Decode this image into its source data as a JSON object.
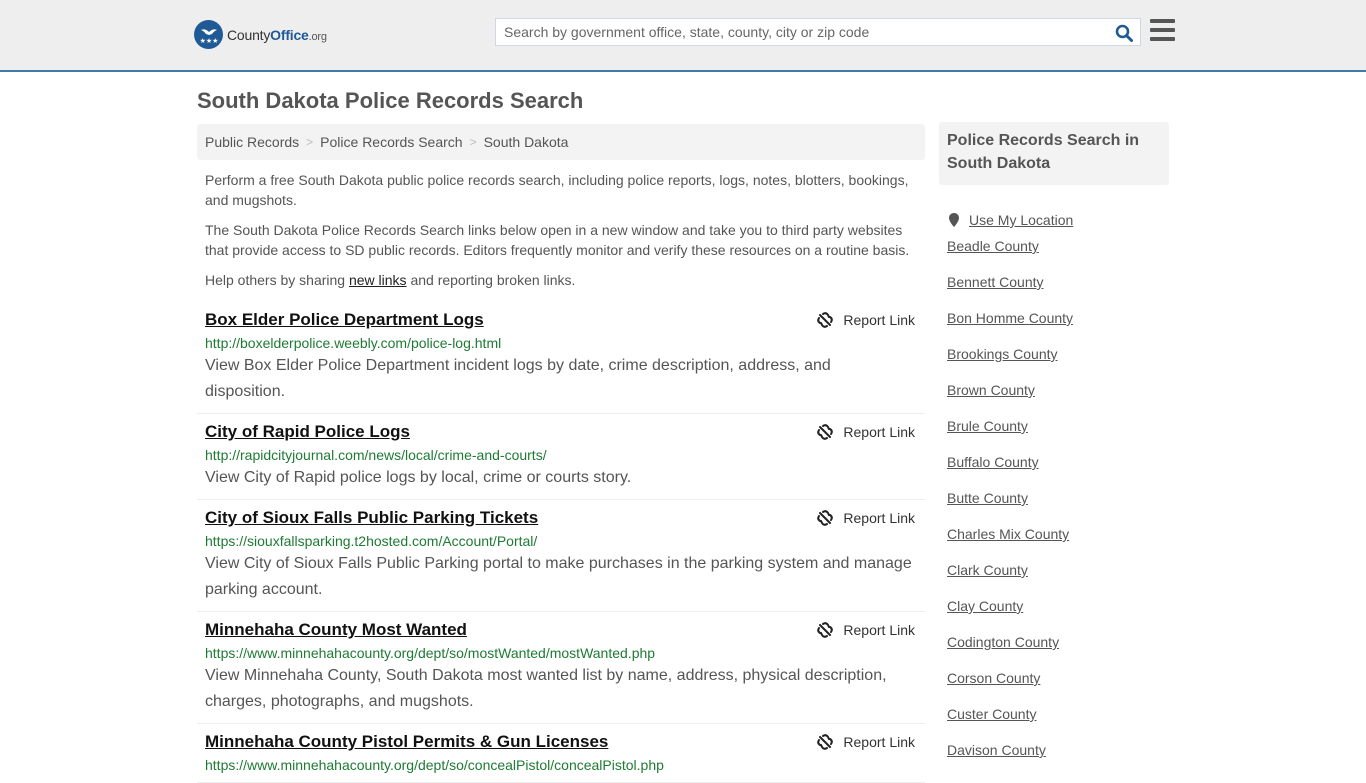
{
  "header": {
    "logo": {
      "name_part1": "County",
      "name_part2": "Office",
      "tld": ".org"
    },
    "search": {
      "placeholder": "Search by government office, state, county, city or zip code",
      "value": ""
    },
    "icons": {
      "search": "search-icon",
      "menu": "hamburger-menu-icon"
    }
  },
  "page": {
    "title": "South Dakota Police Records Search",
    "breadcrumb": [
      "Public Records",
      "Police Records Search",
      "South Dakota"
    ],
    "intro": {
      "p1": "Perform a free South Dakota public police records search, including police reports, logs, notes, blotters, bookings, and mugshots.",
      "p2": "The South Dakota Police Records Search links below open in a new window and take you to third party websites that provide access to SD public records. Editors frequently monitor and verify these resources on a routine basis.",
      "p3_before": "Help others by sharing ",
      "p3_link": "new links",
      "p3_after": " and reporting broken links."
    },
    "report_label": "Report Link",
    "results": [
      {
        "title": "Box Elder Police Department Logs",
        "url": "http://boxelderpolice.weebly.com/police-log.html",
        "description": "View Box Elder Police Department incident logs by date, crime description, address, and disposition."
      },
      {
        "title": "City of Rapid Police Logs",
        "url": "http://rapidcityjournal.com/news/local/crime-and-courts/",
        "description": "View City of Rapid police logs by local, crime or courts story."
      },
      {
        "title": "City of Sioux Falls Public Parking Tickets",
        "url": "https://siouxfallsparking.t2hosted.com/Account/Portal/",
        "description": "View City of Sioux Falls Public Parking portal to make purchases in the parking system and manage parking account."
      },
      {
        "title": "Minnehaha County Most Wanted",
        "url": "https://www.minnehahacounty.org/dept/so/mostWanted/mostWanted.php",
        "description": "View Minnehaha County, South Dakota most wanted list by name, address, physical description, charges, photographs, and mugshots."
      },
      {
        "title": "Minnehaha County Pistol Permits & Gun Licenses",
        "url": "https://www.minnehahacounty.org/dept/so/concealPistol/concealPistol.php",
        "description": ""
      }
    ]
  },
  "sidebar": {
    "heading": "Police Records Search in South Dakota",
    "use_location": "Use My Location",
    "counties": [
      "Beadle County",
      "Bennett County",
      "Bon Homme County",
      "Brookings County",
      "Brown County",
      "Brule County",
      "Buffalo County",
      "Butte County",
      "Charles Mix County",
      "Clark County",
      "Clay County",
      "Codington County",
      "Corson County",
      "Custer County",
      "Davison County"
    ]
  },
  "colors": {
    "brand_blue": "#1f5a97",
    "header_border": "#3e7aad",
    "url_green": "#1e7b34"
  }
}
